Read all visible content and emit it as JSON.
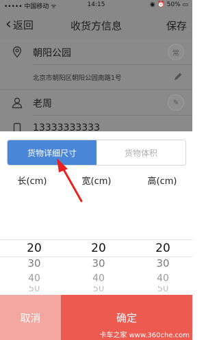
{
  "status_bar": {
    "carrier": "••••• 中国移动 ᯤ",
    "time": "14:15",
    "right": "◉ ⏰ 50% ▭"
  },
  "nav": {
    "back_label": "返回",
    "title": "收货方信息",
    "save_label": "保存"
  },
  "form": {
    "place": "朝阳公园",
    "address": "北京市朝阳区朝阳公园南路1号",
    "contact_name": "老周",
    "phone": "13333333333",
    "tag_place": "常",
    "tag_contact": "✎"
  },
  "sheet": {
    "tabs": [
      {
        "label": "货物详细尺寸",
        "active": true
      },
      {
        "label": "货物体积",
        "active": false
      }
    ],
    "columns": [
      {
        "label": "长(cm)",
        "values": [
          "20",
          "30",
          "40",
          "50"
        ]
      },
      {
        "label": "宽(cm)",
        "values": [
          "20",
          "30",
          "40",
          "50"
        ]
      },
      {
        "label": "高(cm)",
        "values": [
          "20",
          "30",
          "40",
          "50"
        ]
      }
    ],
    "cancel_label": "取消",
    "confirm_label": "确定"
  },
  "watermark": "卡车之家 www.360che.com",
  "colors": {
    "accent_blue": "#4a86d8",
    "confirm_red": "#ec5a50",
    "cancel_pink": "#f3a7a1",
    "arrow_red": "#e8231f"
  }
}
